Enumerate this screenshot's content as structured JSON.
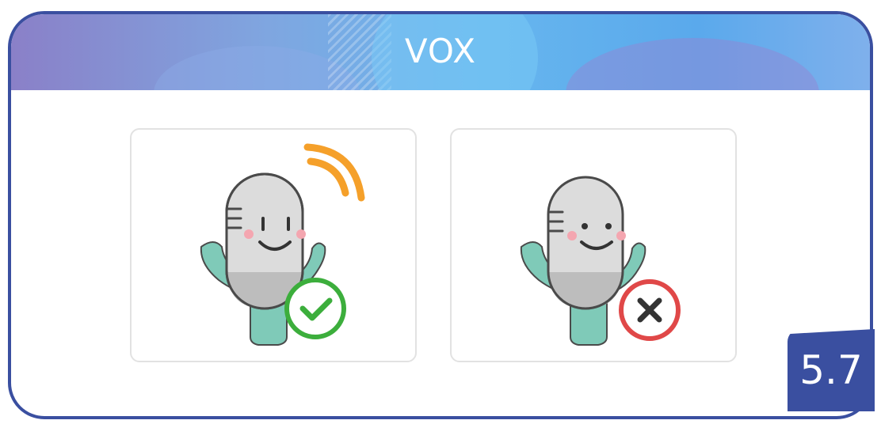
{
  "header": {
    "title": "VOX"
  },
  "badge": {
    "label": "5.7"
  },
  "cards": [
    {
      "state": "on",
      "icons": [
        "microphone-icon",
        "sound-waves-icon",
        "check-icon"
      ]
    },
    {
      "state": "off",
      "icons": [
        "microphone-icon",
        "cross-icon"
      ]
    }
  ],
  "colors": {
    "frame": "#3a4fa0",
    "mic_body": "#dcdcdc",
    "mic_outline": "#4a4a4a",
    "mic_stand": "#7fcab8",
    "waves": "#f5a02a",
    "check": "#3cae3c",
    "cross": "#e04848"
  }
}
